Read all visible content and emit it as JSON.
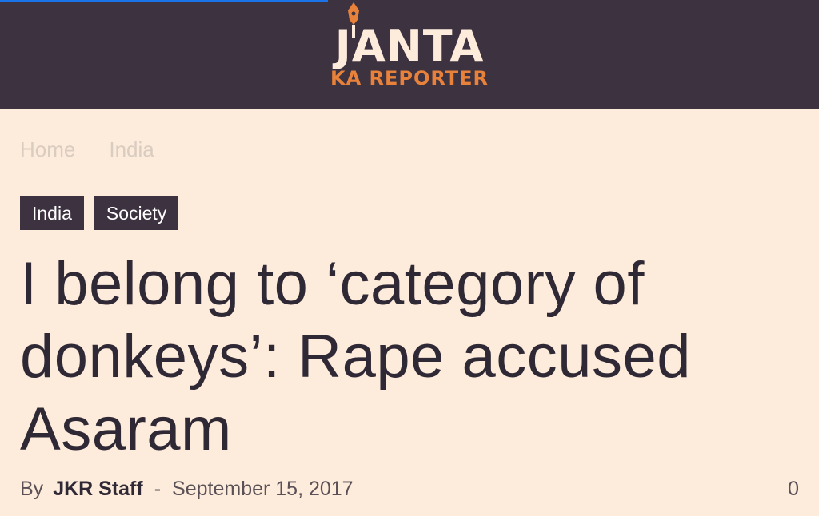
{
  "site": {
    "logo_top": "JANTA",
    "logo_bottom": "KA REPORTER",
    "brand_color": "#e8823a",
    "header_color": "#3d3240"
  },
  "breadcrumb": [
    "Home",
    "India"
  ],
  "tags": [
    "India",
    "Society"
  ],
  "article": {
    "title": "I belong to ‘category of donkeys’: Rape accused Asaram",
    "by_label": "By",
    "author": "JKR Staff",
    "separator": "-",
    "date": "September 15, 2017",
    "comment_count": "0"
  }
}
